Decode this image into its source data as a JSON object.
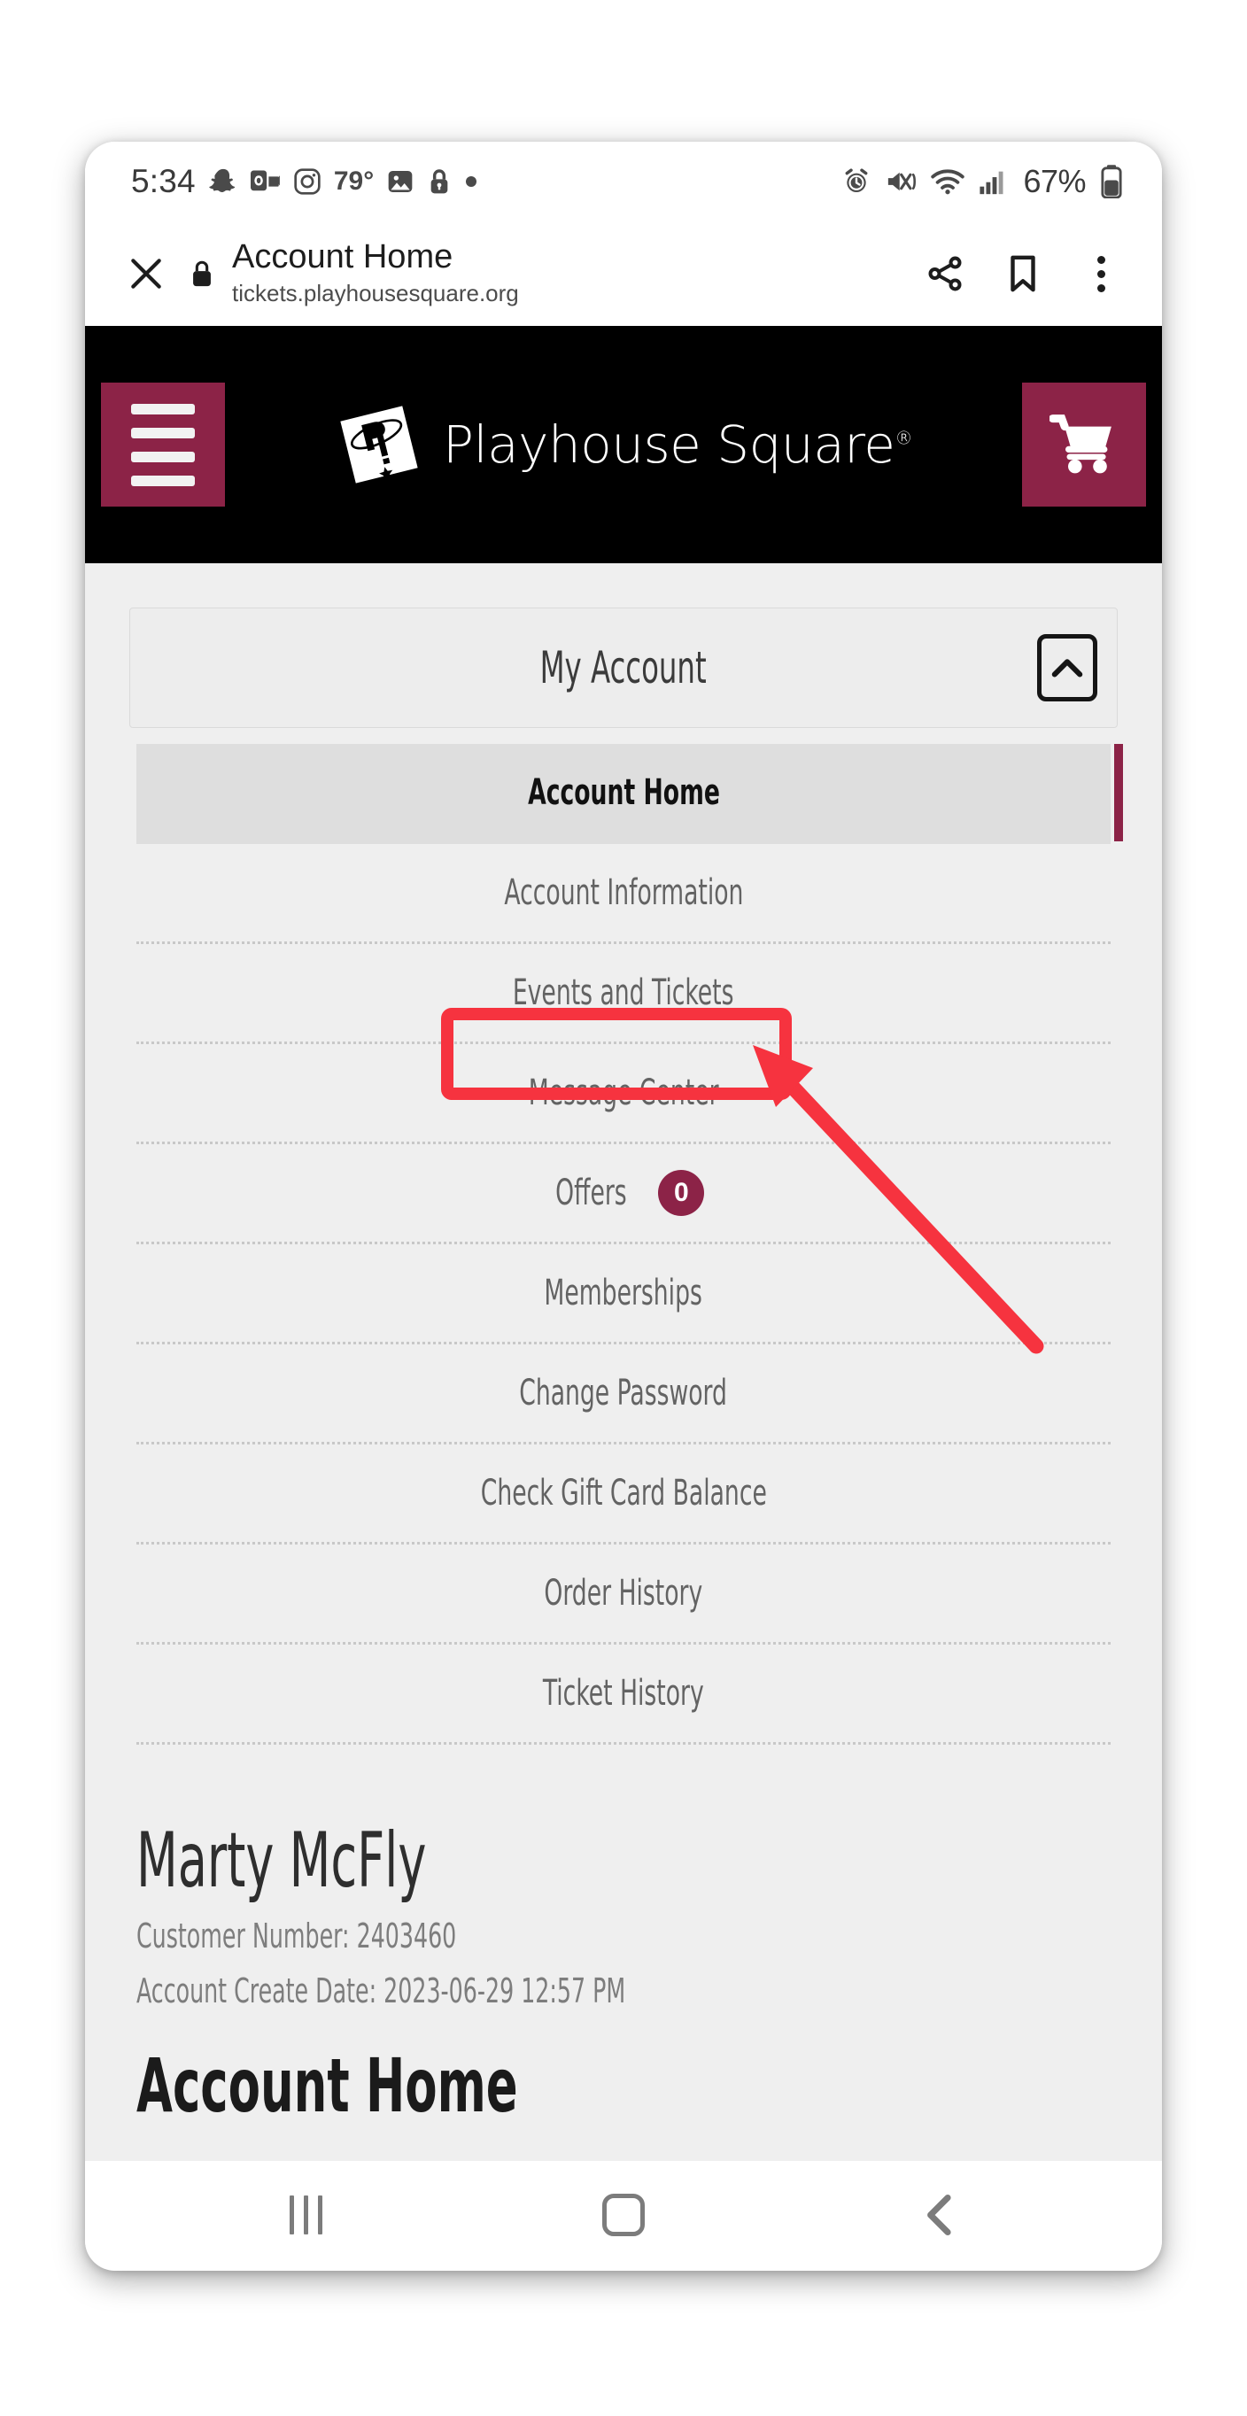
{
  "status_bar": {
    "time": "5:34",
    "temperature": "79°",
    "battery_percent": "67%",
    "left_icons": [
      "snapchat-icon",
      "outlook-icon",
      "instagram-icon",
      "photos-icon",
      "lock-icon",
      "dot-icon"
    ],
    "right_icons": [
      "alarm-icon",
      "mute-vibrate-icon",
      "wifi-icon",
      "signal-icon",
      "battery-icon"
    ]
  },
  "browser_toolbar": {
    "close_label": "✕",
    "page_title": "Account Home",
    "url": "tickets.playhousesquare.org",
    "actions": [
      "share-icon",
      "bookmark-icon",
      "overflow-menu-icon"
    ]
  },
  "site_header": {
    "menu_icon": "hamburger-icon",
    "brand_name": "Playhouse Square",
    "brand_trademark": "®",
    "cart_icon": "shopping-cart-icon",
    "brand_color": "#8c2347",
    "background_color": "#000000"
  },
  "account_panel": {
    "title": "My Account",
    "collapse_icon": "chevron-up-icon"
  },
  "menu": {
    "items": [
      {
        "label": "Account Home",
        "active": true,
        "badge": null
      },
      {
        "label": "Account Information",
        "active": false,
        "badge": null
      },
      {
        "label": "Events and Tickets",
        "active": false,
        "badge": null,
        "highlighted": true
      },
      {
        "label": "Message Center",
        "active": false,
        "badge": null
      },
      {
        "label": "Offers",
        "active": false,
        "badge": "0"
      },
      {
        "label": "Memberships",
        "active": false,
        "badge": null
      },
      {
        "label": "Change Password",
        "active": false,
        "badge": null
      },
      {
        "label": "Check Gift Card Balance",
        "active": false,
        "badge": null
      },
      {
        "label": "Order History",
        "active": false,
        "badge": null
      },
      {
        "label": "Ticket History",
        "active": false,
        "badge": null
      }
    ]
  },
  "profile": {
    "name": "Marty McFly",
    "customer_number": "Customer Number: 2403460",
    "create_date": "Account Create Date: 2023-06-29 12:57 PM",
    "section_heading": "Account Home"
  },
  "nav_bar": {
    "recents_icon": "recents-icon",
    "home_icon": "home-icon",
    "back_icon": "back-icon"
  },
  "annotation": {
    "color": "#f6333f",
    "target": "Events and Tickets",
    "shape": "rounded-rectangle-with-arrow"
  }
}
